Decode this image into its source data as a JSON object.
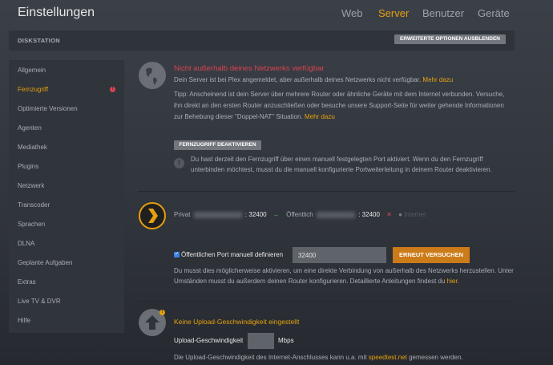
{
  "header": {
    "title": "Einstellungen",
    "nav": [
      "Web",
      "Server",
      "Benutzer",
      "Geräte"
    ],
    "active_nav": "Server"
  },
  "server_bar": {
    "name": "DISKSTATION",
    "toggle_button": "ERWEITERTE OPTIONEN AUSBLENDEN"
  },
  "sidebar": {
    "items": [
      "Allgemein",
      "Fernzugriff",
      "Optimierte Versionen",
      "Agenten",
      "Mediathek",
      "Plugins",
      "Netzwerk",
      "Transcoder",
      "Sprachen",
      "DLNA",
      "Geplante Aufgaben",
      "Extras",
      "Live TV & DVR",
      "Hilfe"
    ],
    "active": "Fernzugriff",
    "warning_badge": "!"
  },
  "remote": {
    "title": "Nicht außerhalb deines Netzwerks verfügbar",
    "desc": "Dein Server ist bei Plex angemeldet, aber außerhalb deines Netzwerks nicht verfügbar.",
    "more_link": "Mehr dazu",
    "tip": "Tipp: Anscheinend ist dein Server über mehrere Router oder ähnliche Geräte mit dem Internet verbunden. Versuche, ihn direkt an den ersten Router anzuschließen oder besuche unsere Support-Seite für weiter gehende Informationen zur Behebung dieser \"Doppel-NAT\" Situation.",
    "tip_link": "Mehr dazu",
    "disable_button": "FERNZUGRIFF DEAKTIVIEREN",
    "info": "Du hast derzeit den Fernzugriff über einen manuell festgelegten Port aktiviert. Wenn du den Fernzugriff unterbinden möchtest, musst du die manuell konfigurierte Portweiterleitung in deinem Router deaktivieren."
  },
  "connection": {
    "private_label": "Privat",
    "private_port": ": 32400",
    "public_label": "Öffentlich",
    "public_port": ": 32400",
    "internet_label": "Internet"
  },
  "manual_port": {
    "checkbox_label": "Öffentlichen Port manuell definieren",
    "checked": true,
    "port_value": "32400",
    "retry_button": "ERNEUT VERSUCHEN",
    "help": "Du musst dies möglicherweise aktivieren, um eine direkte Verbindung von außerhalb des Netzwerks herzustellen. Unter Umständen musst du außerdem deinen Router konfigurieren. Detaillierte Anleitungen findest du",
    "help_link": "hier",
    "help_end": "."
  },
  "upload": {
    "title": "Keine Upload-Geschwindigkeit eingestellt",
    "label": "Upload-Geschwindigkeit",
    "value": "",
    "unit": "Mbps",
    "help_pre": "Die Upload-Geschwindigkeit des Internet-Anschlusses kann u.a. mit",
    "help_link": "speedtest.net",
    "help_post": "gemessen werden."
  },
  "colors": {
    "accent": "#e5a00d",
    "error": "#d9434f",
    "button": "#cc7b19"
  }
}
